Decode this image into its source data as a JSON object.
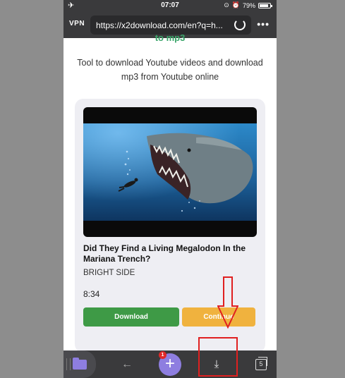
{
  "status_bar": {
    "time": "07:07",
    "battery": "79%"
  },
  "browser": {
    "vpn_label": "VPN",
    "url": "https://x2download.com/en?q=h..."
  },
  "page": {
    "heading_tail": "to mp3",
    "tagline": "Tool to download Youtube videos and download mp3 from Youtube online"
  },
  "video": {
    "title": "Did They Find a Living Megalodon In the Mariana Trench?",
    "channel": "BRIGHT SIDE",
    "duration": "8:34",
    "download_label": "Download",
    "continue_label": "Continue"
  },
  "toolbar": {
    "downloads_badge": "1",
    "tab_count": "5",
    "new_tab_symbol": "+",
    "back_symbol": "←",
    "download_symbol": "⤓"
  },
  "colors": {
    "download_button": "#3e9a46",
    "continue_button": "#f0b23e",
    "accent_purple": "#8e7ee0",
    "annotation_red": "#e02020"
  }
}
